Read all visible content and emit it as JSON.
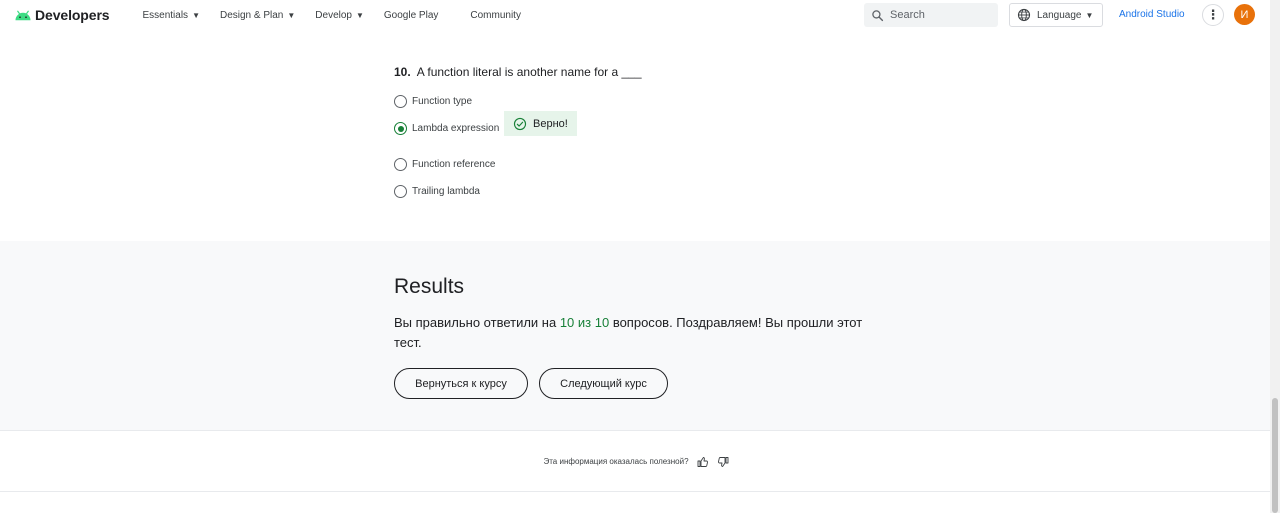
{
  "header": {
    "logo_text": "Developers",
    "nav": [
      {
        "label": "Essentials",
        "has_menu": true
      },
      {
        "label": "Design & Plan",
        "has_menu": true
      },
      {
        "label": "Develop",
        "has_menu": true
      },
      {
        "label": "Google Play",
        "has_menu": false
      },
      {
        "label": "Community",
        "has_menu": false
      }
    ],
    "search_placeholder": "Search",
    "language_label": "Language",
    "studio_link": "Android Studio",
    "avatar_initial": "И",
    "colors": {
      "android_green": "#3ddc84",
      "link_blue": "#1a73e8",
      "avatar": "#e8710a"
    }
  },
  "question": {
    "number": "10.",
    "text": "A function literal is another name for a ___",
    "options": [
      {
        "label": "Function type",
        "selected": false
      },
      {
        "label": "Lambda expression",
        "selected": true
      },
      {
        "label": "Function reference",
        "selected": false
      },
      {
        "label": "Trailing lambda",
        "selected": false
      }
    ],
    "correct_label": "Верно!",
    "correct_color": "#188038"
  },
  "results": {
    "title": "Results",
    "text_before": "Вы правильно ответили на ",
    "score": "10 из 10",
    "text_after": " вопросов. Поздравляем! Вы прошли этот тест.",
    "back_button": "Вернуться к курсу",
    "next_button": "Следующий курс"
  },
  "feedback": {
    "question": "Эта информация оказалась полезной?"
  }
}
